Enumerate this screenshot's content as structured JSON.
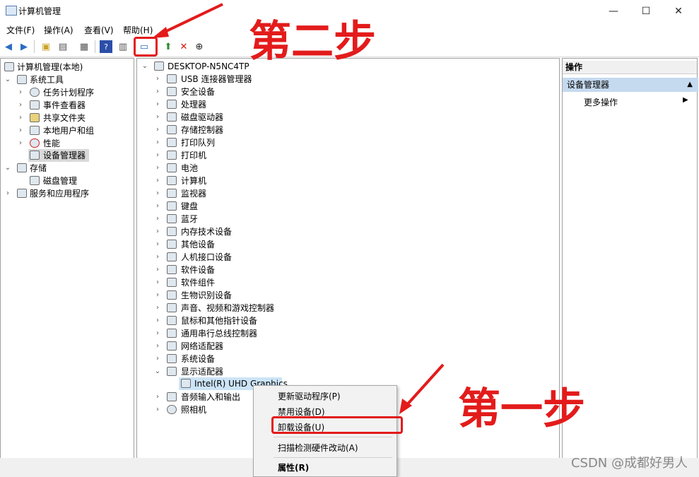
{
  "window": {
    "title": "计算机管理",
    "minimize": "—",
    "maximize": "☐",
    "close": "✕"
  },
  "menu": [
    "文件(F)",
    "操作(A)",
    "查看(V)",
    "帮助(H)"
  ],
  "left_tree": [
    {
      "label": "计算机管理(本地)",
      "level": 0,
      "chevron": ""
    },
    {
      "label": "系统工具",
      "level": 1,
      "chevron": "⌄"
    },
    {
      "label": "任务计划程序",
      "level": 2,
      "chevron": "›"
    },
    {
      "label": "事件查看器",
      "level": 2,
      "chevron": "›"
    },
    {
      "label": "共享文件夹",
      "level": 2,
      "chevron": "›"
    },
    {
      "label": "本地用户和组",
      "level": 2,
      "chevron": "›"
    },
    {
      "label": "性能",
      "level": 2,
      "chevron": "›"
    },
    {
      "label": "设备管理器",
      "level": 2,
      "chevron": "",
      "selected": true
    },
    {
      "label": "存储",
      "level": 1,
      "chevron": "⌄"
    },
    {
      "label": "磁盘管理",
      "level": 2,
      "chevron": ""
    },
    {
      "label": "服务和应用程序",
      "level": 1,
      "chevron": "›"
    }
  ],
  "device_tree": {
    "root": "DESKTOP-N5NC4TP",
    "categories": [
      "USB 连接器管理器",
      "安全设备",
      "处理器",
      "磁盘驱动器",
      "存储控制器",
      "打印队列",
      "打印机",
      "电池",
      "计算机",
      "监视器",
      "键盘",
      "蓝牙",
      "内存技术设备",
      "其他设备",
      "人机接口设备",
      "软件设备",
      "软件组件",
      "生物识别设备",
      "声音、视频和游戏控制器",
      "鼠标和其他指针设备",
      "通用串行总线控制器",
      "网络适配器",
      "系统设备",
      "显示适配器"
    ],
    "expanded_child": "Intel(R) UHD Graphics",
    "after": [
      "音频输入和输出",
      "照相机"
    ]
  },
  "actions": {
    "header": "操作",
    "section": "设备管理器",
    "more": "更多操作",
    "collapse_glyph": "▲",
    "more_glyph": "▶"
  },
  "context_menu": {
    "items": [
      "更新驱动程序(P)",
      "禁用设备(D)",
      "卸载设备(U)",
      "扫描检测硬件改动(A)",
      "属性(R)"
    ]
  },
  "annotations": {
    "step2": "第二步",
    "step1": "第一步"
  },
  "watermark": "CSDN @成都好男人",
  "colors": {
    "annotation": "#e31b1b",
    "selection": "#c5d9ef"
  }
}
